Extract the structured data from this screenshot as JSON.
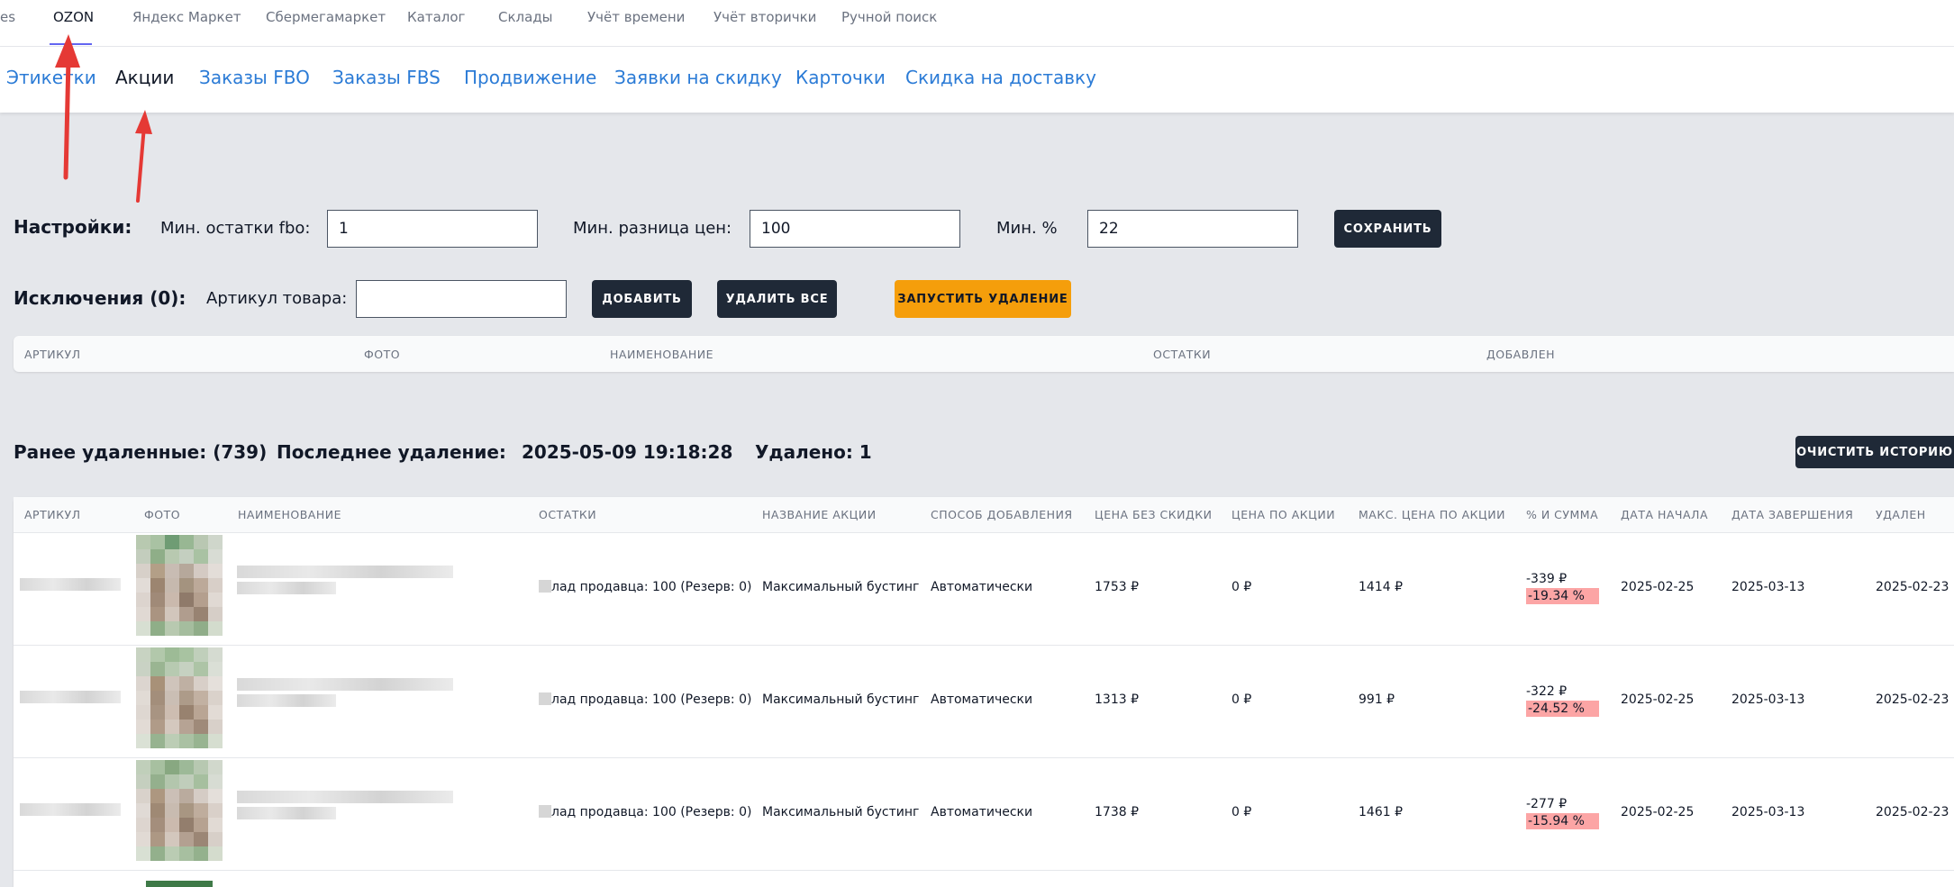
{
  "topnav": {
    "items": [
      "es",
      "OZON",
      "Яндекс Маркет",
      "Сбермегамаркет",
      "Каталог",
      "Склады",
      "Учёт времени",
      "Учёт вторички",
      "Ручной поиск"
    ],
    "active": "OZON"
  },
  "subnav": {
    "items": [
      "Этикетки",
      "Акции",
      "Заказы FBO",
      "Заказы FBS",
      "Продвижение",
      "Заявки на скидку",
      "Карточки",
      "Скидка на доставку"
    ],
    "active": "Акции"
  },
  "settings": {
    "title": "Настройки:",
    "min_stock_label": "Мин. остатки fbo:",
    "min_stock_value": "1",
    "min_price_diff_label": "Мин. разница цен:",
    "min_price_diff_value": "100",
    "min_pct_label": "Мин. %",
    "min_pct_value": "22",
    "save_label": "СОХРАНИТЬ"
  },
  "exclusions": {
    "title": "Исключения (0):",
    "article_label": "Артикул товара:",
    "article_value": "",
    "add_label": "ДОБАВИТЬ",
    "delete_all_label": "УДАЛИТЬ ВСЕ",
    "run_delete_label": "ЗАПУСТИТЬ УДАЛЕНИЕ",
    "columns": [
      "АРТИКУЛ",
      "ФОТО",
      "НАИМЕНОВАНИЕ",
      "ОСТАТКИ",
      "ДОБАВЛЕН"
    ]
  },
  "history": {
    "deleted_label": "Ранее удаленные: (739)",
    "last_delete_label": "Последнее удаление:",
    "last_delete_value": "2025-05-09 19:18:28",
    "removed_label": "Удалено: 1",
    "clear_label": "ОЧИСТИТЬ ИСТОРИЮ",
    "columns": [
      "АРТИКУЛ",
      "ФОТО",
      "НАИМЕНОВАНИЕ",
      "ОСТАТКИ",
      "НАЗВАНИЕ АКЦИИ",
      "СПОСОБ ДОБАВЛЕНИЯ",
      "ЦЕНА БЕЗ СКИДКИ",
      "ЦЕНА ПО АКЦИИ",
      "МАКС. ЦЕНА ПО АКЦИИ",
      "% И СУММА",
      "ДАТА НАЧАЛА",
      "ДАТА ЗАВЕРШЕНИЯ",
      "УДАЛЕН"
    ],
    "rows": [
      {
        "stock": "лад продавца: 100 (Резерв: 0)",
        "action": "Максимальный бустинг",
        "method": "Автоматически",
        "price": "1753 ₽",
        "action_price": "0 ₽",
        "max_price": "1414 ₽",
        "sum": "-339 ₽",
        "pct": "-19.34 %",
        "start": "2025-02-25",
        "end": "2025-03-13",
        "removed": "2025-02-23"
      },
      {
        "stock": "лад продавца: 100 (Резерв: 0)",
        "action": "Максимальный бустинг",
        "method": "Автоматически",
        "price": "1313 ₽",
        "action_price": "0 ₽",
        "max_price": "991 ₽",
        "sum": "-322 ₽",
        "pct": "-24.52 %",
        "start": "2025-02-25",
        "end": "2025-03-13",
        "removed": "2025-02-23"
      },
      {
        "stock": "лад продавца: 100 (Резерв: 0)",
        "action": "Максимальный бустинг",
        "method": "Автоматически",
        "price": "1738 ₽",
        "action_price": "0 ₽",
        "max_price": "1461 ₽",
        "sum": "-277 ₽",
        "pct": "-15.94 %",
        "start": "2025-02-25",
        "end": "2025-03-13",
        "removed": "2025-02-23"
      }
    ]
  },
  "colors": {
    "link": "#2b7bd6",
    "dark_button": "#1f2937",
    "orange_button": "#f59e0b",
    "annotation_arrow": "#e53935",
    "pct_badge": "#fca5a5"
  }
}
